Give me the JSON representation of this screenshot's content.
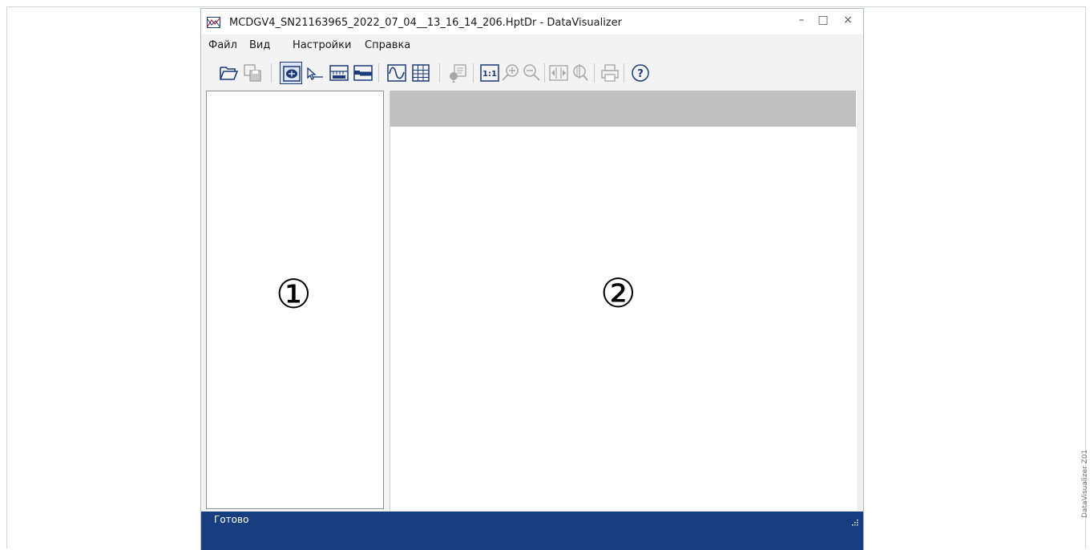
{
  "window": {
    "title": "MCDGV4_SN21163965_2022_07_04__13_16_14_206.HptDr - DataVisualizer",
    "controls": {
      "minimize": "–",
      "maximize": "□",
      "close": "×"
    }
  },
  "menu": {
    "items": [
      {
        "label": "Файл"
      },
      {
        "label": "Вид"
      },
      {
        "label": "Настройки"
      },
      {
        "label": "Справка"
      }
    ]
  },
  "toolbar": {
    "buttons": [
      {
        "icon": "open-folder-icon",
        "enabled": true
      },
      {
        "icon": "save-icon",
        "enabled": false
      },
      {
        "icon": "navigation-view-icon",
        "enabled": true,
        "pressed": true
      },
      {
        "icon": "pointer-icon",
        "enabled": true
      },
      {
        "icon": "numbered-scale-icon",
        "enabled": true
      },
      {
        "icon": "digital-signal-icon",
        "enabled": true
      },
      {
        "icon": "analog-wave-icon",
        "enabled": true
      },
      {
        "icon": "table-grid-icon",
        "enabled": true
      },
      {
        "icon": "properties-icon",
        "enabled": false
      },
      {
        "icon": "one-to-one-icon",
        "label": "1:1",
        "enabled": true
      },
      {
        "icon": "zoom-in-icon",
        "enabled": false
      },
      {
        "icon": "zoom-out-icon",
        "enabled": false
      },
      {
        "icon": "fit-horizontal-icon",
        "enabled": false
      },
      {
        "icon": "zoom-fit-icon",
        "enabled": false
      },
      {
        "icon": "print-icon",
        "enabled": false
      },
      {
        "icon": "help-icon",
        "enabled": true
      }
    ]
  },
  "callouts": {
    "left": "①",
    "right": "②"
  },
  "status": {
    "text": "Готово"
  },
  "side_label": "DataVisualizer Z01",
  "colors": {
    "status_bar": "#173f7f",
    "accent": "#1a3a7a",
    "icon_enabled": "#1a3a7a",
    "icon_disabled": "#a8a8a8",
    "header_strip": "#c0c0c0"
  }
}
